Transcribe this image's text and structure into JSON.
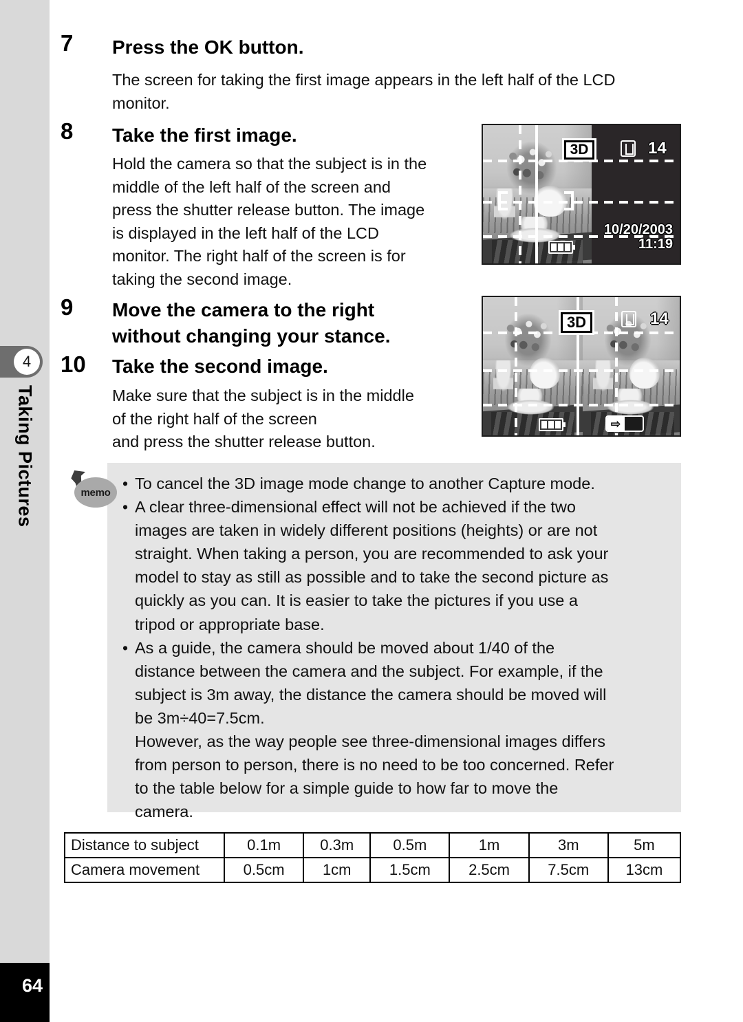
{
  "sidebar": {
    "chapter_number": "4",
    "chapter_title": "Taking Pictures",
    "page_number": "64"
  },
  "steps": [
    {
      "number": "7",
      "heading": "Press the OK button.",
      "body_lines": [
        "The screen for taking the first image appears in the left half of the LCD",
        "monitor."
      ]
    },
    {
      "number": "8",
      "heading": "Take the first image.",
      "body_lines": [
        "Hold the camera so that the subject is in the",
        "middle of the left half of the screen and",
        "press the shutter release button. The image",
        "is displayed in the left half of the LCD",
        "monitor. The right half of the screen is for",
        "taking the second image."
      ]
    },
    {
      "number": "9",
      "heading_lines": [
        "Move the camera to the right",
        "without changing your stance."
      ],
      "body_lines": []
    },
    {
      "number": "10",
      "heading": "Take the second image.",
      "body_lines": [
        "Make sure that the subject is in the middle",
        "of the right half of the screen",
        "and press the shutter release button."
      ]
    }
  ],
  "lcd_first": {
    "mode_badge": "3D",
    "remaining_shots": "14",
    "date": "10/20/2003",
    "time": "11:19",
    "card_icon": "memory-card-icon",
    "battery_icon": "battery-full-icon"
  },
  "lcd_second": {
    "mode_badge": "3D",
    "remaining_shots": "14",
    "card_icon": "memory-card-icon",
    "battery_icon": "battery-full-icon",
    "arrow_icon": "right-arrow-icon",
    "arrow_glyph": "⇨"
  },
  "memo": {
    "icon_label": "memo",
    "items": [
      {
        "bullet": "•",
        "lines": [
          "To cancel the 3D image mode change to another Capture mode."
        ]
      },
      {
        "bullet": "•",
        "lines": [
          "A clear three-dimensional effect will not be achieved if the two",
          "images are taken in widely different positions (heights) or are not",
          "straight. When taking a person, you are recommended to ask your",
          "model to stay as still as possible and to take the second picture as",
          "quickly as you can. It is easier to take the pictures if you use a",
          "tripod or appropriate base."
        ]
      },
      {
        "bullet": "•",
        "lines": [
          "As a guide, the camera should be moved about 1/40 of the",
          "distance between the camera and the subject. For example, if the",
          "subject is 3m away, the distance the camera should be moved will",
          "be 3m÷40=7.5cm."
        ],
        "sub_lines": [
          "However, as the way people see three-dimensional images differs",
          "from person to person, there is no need to be too concerned. Refer",
          "to the table below for a simple guide to how far to move the",
          "camera."
        ]
      }
    ]
  },
  "guide_table": {
    "rows": [
      {
        "label": "Distance to subject",
        "values": [
          "0.1m",
          "0.3m",
          "0.5m",
          "1m",
          "3m",
          "5m"
        ]
      },
      {
        "label": "Camera movement",
        "values": [
          "0.5cm",
          "1cm",
          "1.5cm",
          "2.5cm",
          "7.5cm",
          "13cm"
        ]
      }
    ]
  },
  "colors": {
    "sidebar_bg": "#d9d9d9",
    "chapter_tab": "#6e6e6e",
    "memo_bg": "#e5e5e5",
    "page_band": "#000000"
  }
}
